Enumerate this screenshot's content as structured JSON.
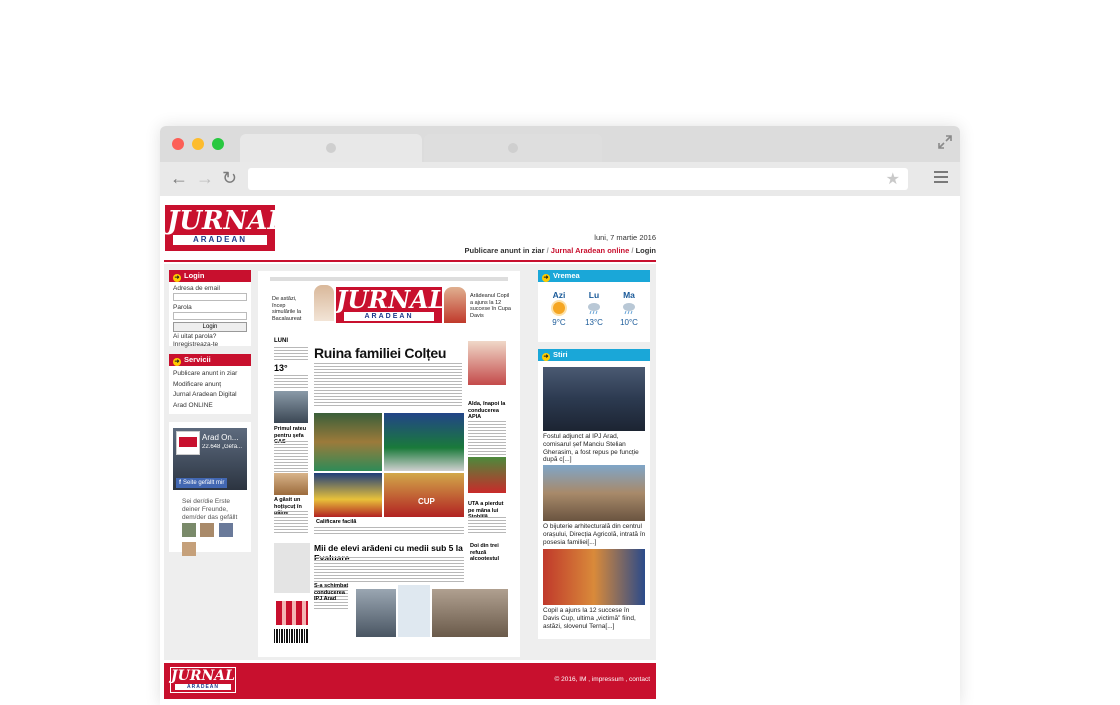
{
  "site": {
    "logo": {
      "top": "JURNAL",
      "bottom": "ARADEAN"
    },
    "date": "luni, 7 martie 2016",
    "topnav": {
      "publicare": "Publicare anunt in ziar",
      "sep": "/",
      "online": "Jurnal Aradean online",
      "login": "Login"
    },
    "login": {
      "title": "Login",
      "email_label": "Adresa de email",
      "password_label": "Parola",
      "button": "Login",
      "forgot": "Ai uitat parola?",
      "register": "Inregistreaza-te"
    },
    "services": {
      "title": "Servicii",
      "items": [
        "Publicare anunt in ziar",
        "Modificare anunț",
        "Jurnal Aradean Digital",
        "Arad ONLINE"
      ]
    },
    "facebook": {
      "page_name": "Arad On...",
      "likes": "22.648 „Gefä...",
      "like_button": "Seite gefällt mir",
      "friends_text": "Sei der/die Erste deiner Freunde, dem/der das gefällt"
    },
    "frontpage": {
      "teaser_left": "De astăzi, încep simulările la Bacalaureat",
      "teaser_right": "Arădeanul Copil a ajuns la 12 succese în Cupa Davis",
      "headline": "Ruina familiei Colțeu",
      "headline2": "Mii de elevi arădeni cu medii sub 5 la Evaluare",
      "day": "LUNI",
      "temp": "13°",
      "side1": "Primul rateu pentru șefa CAS",
      "side2": "A găsit un hoțișcuț în pâine",
      "side3": "Alda, înapoi la conducerea APIA",
      "side4": "UTA a pierdut pe mâna lui Stoblilă",
      "side5": "Doi din trei refuză alcootestul",
      "side6": "S-a schimbat conducerea IPJ Arad",
      "caption": "Calificare facilă",
      "cup": "CUP"
    },
    "weather": {
      "title": "Vremea",
      "days": [
        {
          "day": "Azi",
          "temp": "9°C",
          "icon": "sun-icon"
        },
        {
          "day": "Lu",
          "temp": "13°C",
          "icon": "rain-icon"
        },
        {
          "day": "Ma",
          "temp": "10°C",
          "icon": "rain-icon"
        }
      ]
    },
    "news": {
      "title": "Stiri",
      "items": [
        {
          "caption": "Fostul adjunct al IPJ Arad, comisarul șef Manciu Stelian Gherasim, a fost repus pe funcție după c[...]"
        },
        {
          "caption": "O bijuterie arhitecturală din centrul orașului, Direcția Agricolă, intrată în posesia familiei[...]"
        },
        {
          "caption": "Copil a ajuns la 12 succese în Davis Cup, ultima „victimă” fiind, astăzi, slovenul Terna[...]"
        }
      ]
    },
    "footer": {
      "text": "© 2016, IM , impressum , contact"
    }
  },
  "colors": {
    "brand_red": "#c8102e",
    "brand_blue": "#1e3a8a",
    "accent_cyan": "#1aa7d8",
    "arrow_yellow": "#ffcc00"
  }
}
